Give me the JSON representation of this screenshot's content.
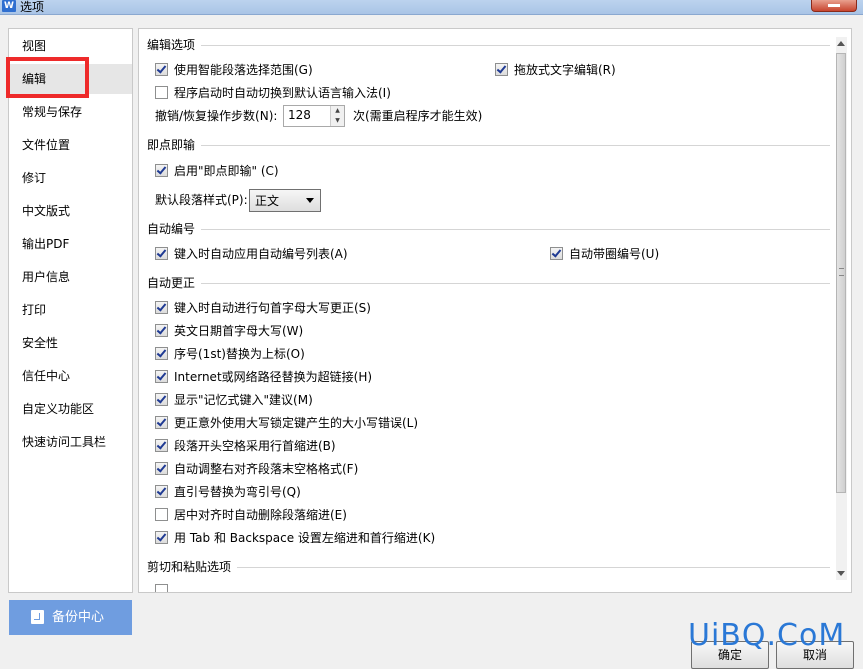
{
  "window": {
    "title": "选项",
    "app_icon_letter": "W"
  },
  "sidebar": {
    "items": [
      {
        "label": "视图"
      },
      {
        "label": "编辑",
        "selected": true
      },
      {
        "label": "常规与保存"
      },
      {
        "label": "文件位置"
      },
      {
        "label": "修订"
      },
      {
        "label": "中文版式"
      },
      {
        "label": "输出PDF"
      },
      {
        "label": "用户信息"
      },
      {
        "label": "打印"
      },
      {
        "label": "安全性"
      },
      {
        "label": "信任中心"
      },
      {
        "label": "自定义功能区"
      },
      {
        "label": "快速访问工具栏"
      }
    ]
  },
  "backup_button": {
    "label": "备份中心"
  },
  "edit_options": {
    "heading": "编辑选项",
    "smart_paragraph": {
      "label": "使用智能段落选择范围(G)",
      "checked": true
    },
    "drag_drop": {
      "label": "拖放式文字编辑(R)",
      "checked": true
    },
    "auto_ime": {
      "label": "程序启动时自动切换到默认语言输入法(I)",
      "checked": false
    },
    "undo_steps": {
      "label": "撤销/恢复操作步数(N):",
      "value": "128",
      "suffix": "次(需重启程序才能生效)"
    }
  },
  "click_and_type": {
    "heading": "即点即输",
    "enable": {
      "label": "启用\"即点即输\" (C)",
      "checked": true
    },
    "default_style": {
      "label": "默认段落样式(P):",
      "value": "正文"
    }
  },
  "auto_number": {
    "heading": "自动编号",
    "auto_list": {
      "label": "键入时自动应用自动编号列表(A)",
      "checked": true
    },
    "circle_number": {
      "label": "自动带圈编号(U)",
      "checked": true
    }
  },
  "auto_correct": {
    "heading": "自动更正",
    "items": [
      {
        "label": "键入时自动进行句首字母大写更正(S)",
        "checked": true
      },
      {
        "label": "英文日期首字母大写(W)",
        "checked": true
      },
      {
        "label": "序号(1st)替换为上标(O)",
        "checked": true
      },
      {
        "label": "Internet或网络路径替换为超链接(H)",
        "checked": true
      },
      {
        "label": "显示\"记忆式键入\"建议(M)",
        "checked": true
      },
      {
        "label": "更正意外使用大写锁定键产生的大小写错误(L)",
        "checked": true
      },
      {
        "label": "段落开头空格采用行首缩进(B)",
        "checked": true
      },
      {
        "label": "自动调整右对齐段落末空格格式(F)",
        "checked": true
      },
      {
        "label": "直引号替换为弯引号(Q)",
        "checked": true
      },
      {
        "label": "居中对齐时自动删除段落缩进(E)",
        "checked": false
      },
      {
        "label": "用 Tab 和 Backspace 设置左缩进和首行缩进(K)",
        "checked": true
      }
    ]
  },
  "cut_paste": {
    "heading": "剪切和粘贴选项"
  },
  "buttons": {
    "ok": "确定",
    "cancel": "取消"
  },
  "watermark": "UiBQ.CoM",
  "colors": {
    "highlight": "#ee2a2a",
    "accent": "#6f9de0",
    "watermark": "#2a78d6"
  }
}
